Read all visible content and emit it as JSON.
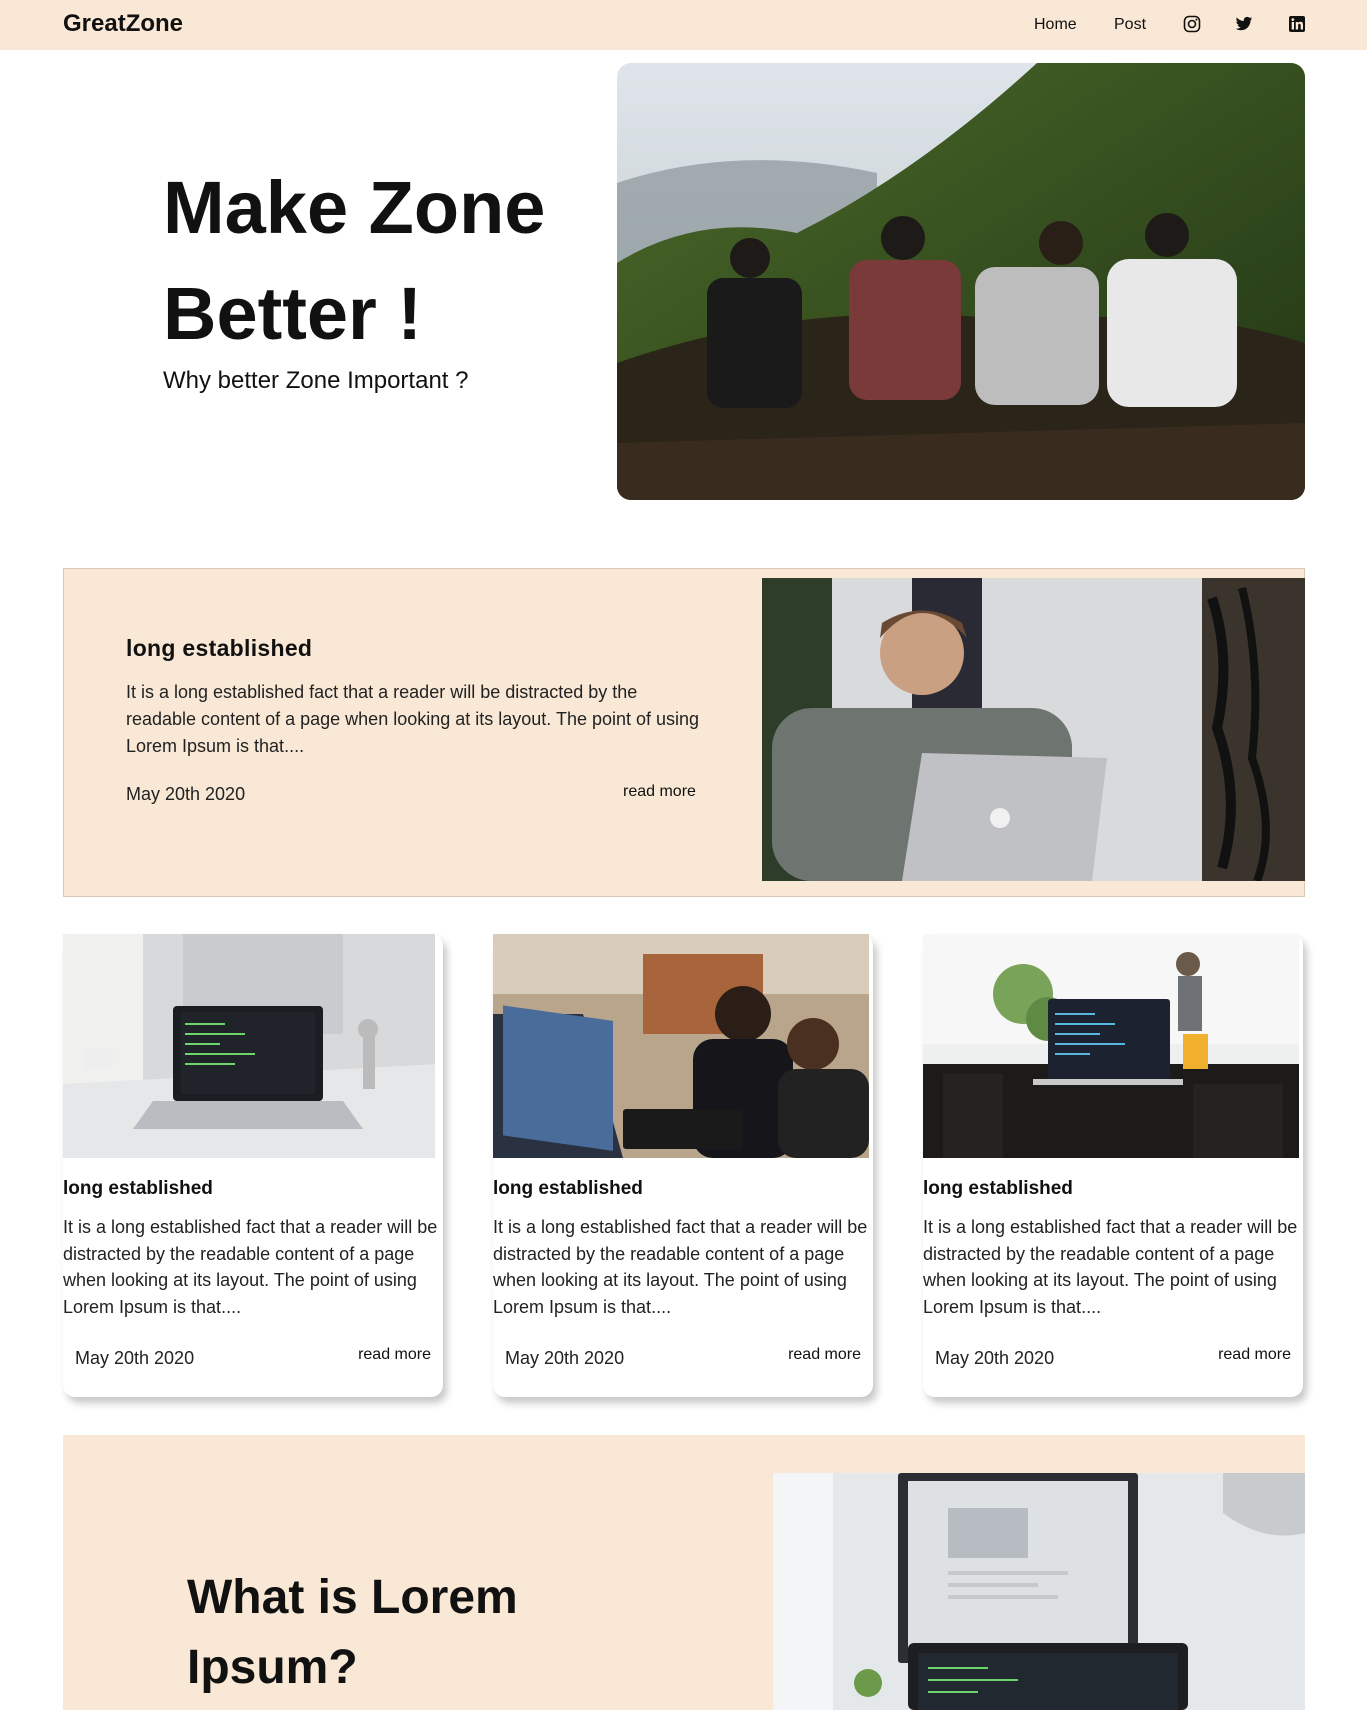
{
  "nav": {
    "brand": "GreatZone",
    "links": [
      "Home",
      "Post"
    ],
    "icons": [
      "instagram-icon",
      "twitter-icon",
      "linkedin-icon"
    ]
  },
  "hero": {
    "title": "Make Zone Better !",
    "subtitle": "Why better Zone Important ?"
  },
  "featured": {
    "title": "long established",
    "text": "It is a long established fact that a reader will be distracted by the readable content of a page when looking at its layout. The point of using Lorem Ipsum is that....",
    "date": "May 20th 2020",
    "more": "read more"
  },
  "cards": [
    {
      "title": "long established",
      "text": "It is a long established fact that a reader will be distracted by the readable content of a page when looking at its layout. The point of using Lorem Ipsum is that....",
      "date": "May 20th 2020",
      "more": "read more"
    },
    {
      "title": "long established",
      "text": "It is a long established fact that a reader will be distracted by the readable content of a page when looking at its layout. The point of using Lorem Ipsum is that....",
      "date": "May 20th 2020",
      "more": "read more"
    },
    {
      "title": "long established",
      "text": "It is a long established fact that a reader will be distracted by the readable content of a page when looking at its layout. The point of using Lorem Ipsum is that....",
      "date": "May 20th 2020",
      "more": "read more"
    }
  ],
  "lower": {
    "title": "What is Lorem Ipsum?"
  },
  "colors": {
    "accent_bg": "#f9e8d5",
    "text": "#111111"
  }
}
